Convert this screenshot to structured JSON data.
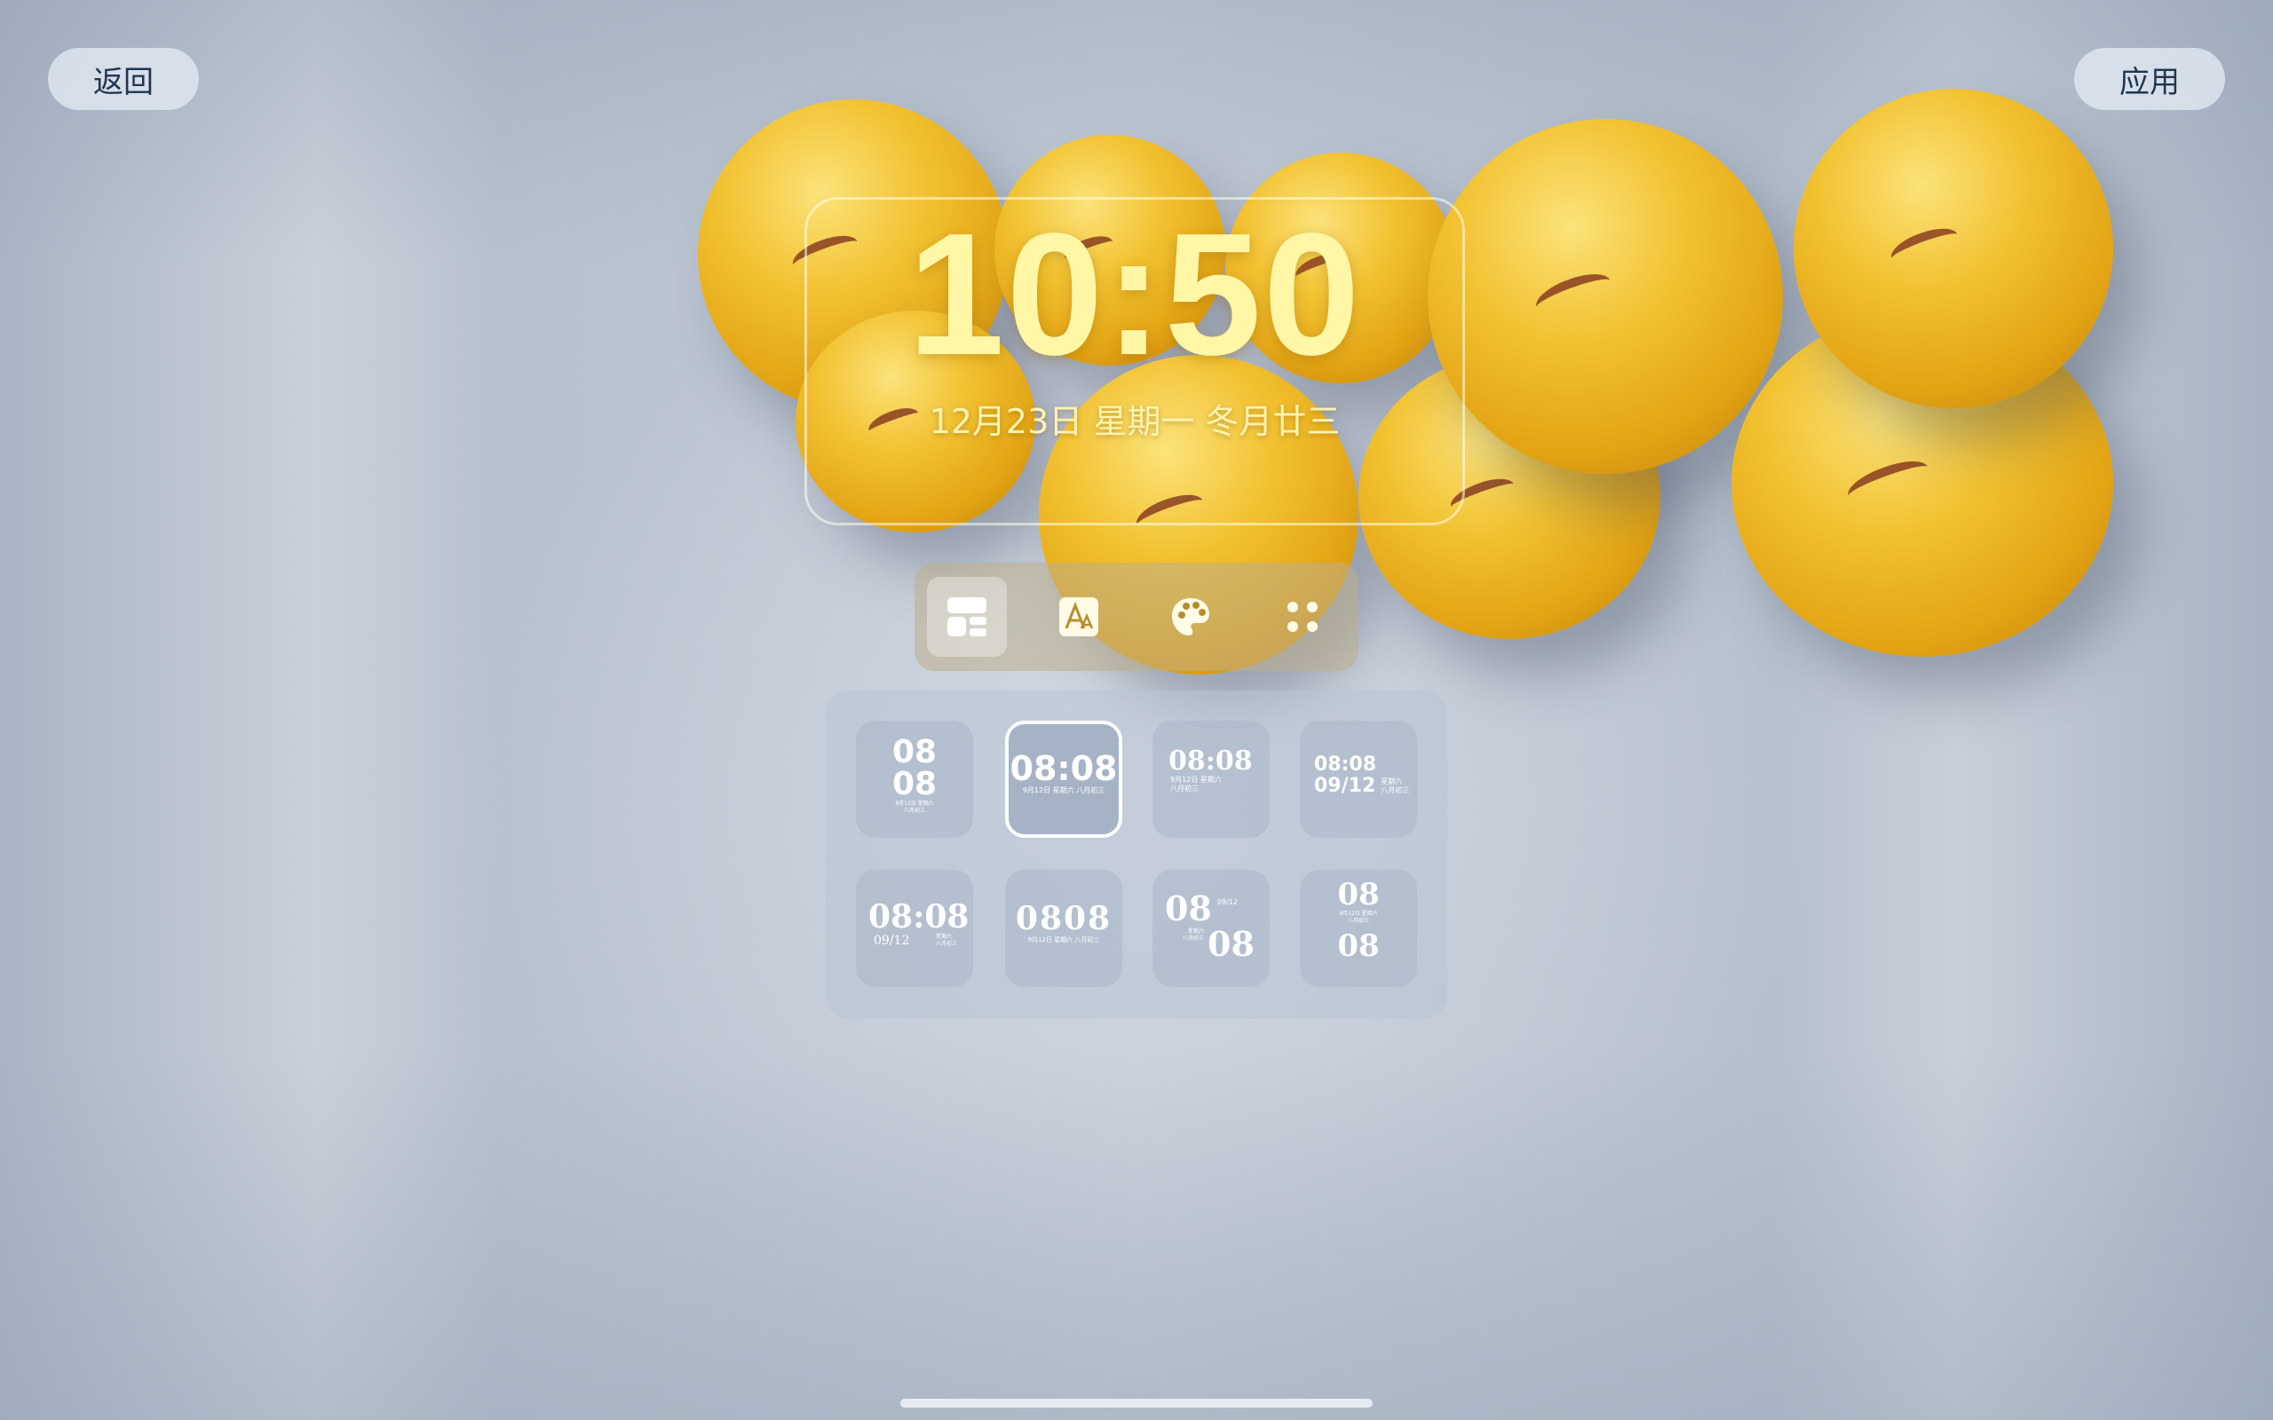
{
  "header": {
    "back_label": "返回",
    "apply_label": "应用"
  },
  "clock": {
    "time": "10:50",
    "date": "12月23日  星期一  冬月廿三"
  },
  "toolbar": {
    "tools": [
      {
        "icon": "layout-icon",
        "active": true
      },
      {
        "icon": "font-icon",
        "active": false
      },
      {
        "icon": "palette-icon",
        "active": false
      },
      {
        "icon": "more-icon",
        "active": false
      }
    ]
  },
  "styles": {
    "s1": {
      "top": "08",
      "bottom": "08",
      "line1": "9月12日 星期六",
      "line2": "八月初三"
    },
    "s2": {
      "time": "08:08",
      "line": "9月12日 星期六 八月初三"
    },
    "s3": {
      "time": "08:08",
      "line1": "9月12日 星期六",
      "line2": "八月初三"
    },
    "s4": {
      "time": "08:08",
      "date": "09/12",
      "line1": "星期六",
      "line2": "八月初三"
    },
    "s5": {
      "time": "08:08",
      "date": "09/12",
      "line1": "星期六",
      "line2": "八月初三"
    },
    "s6": {
      "time": "0808",
      "line": "9月12日 星期六 八月初三"
    },
    "s7": {
      "top": "08",
      "bottom": "08",
      "date": "09/12",
      "line1": "星期六",
      "line2": "八月初三"
    },
    "s8": {
      "top": "08",
      "bottom": "08",
      "line1": "9月12日 星期六",
      "line2": "八月初三"
    }
  },
  "colors": {
    "clock_text": "#fff6a6",
    "ball_yellow": "#f2c232",
    "button_text": "#1f3550"
  }
}
